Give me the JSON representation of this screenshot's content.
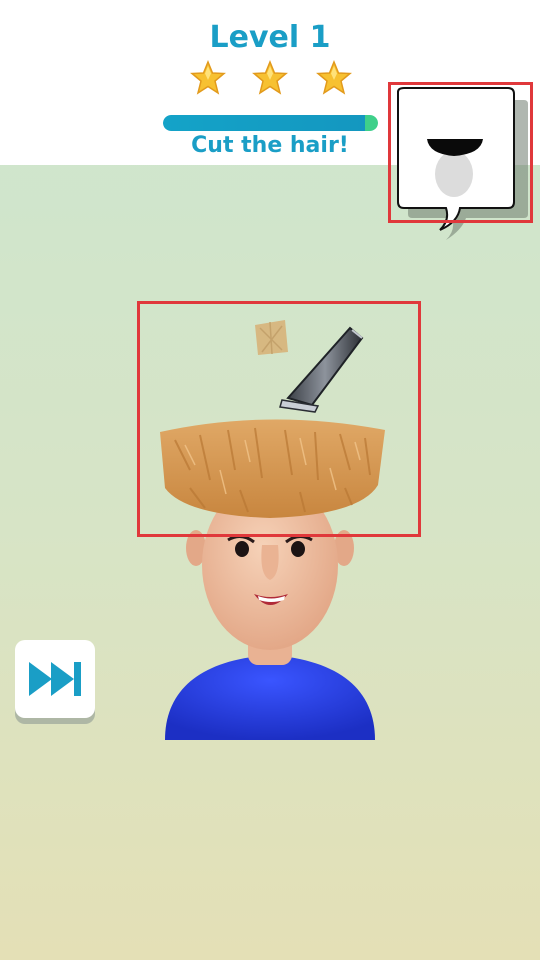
{
  "header": {
    "level_label": "Level 1",
    "stars_total": 3,
    "stars_earned": 3,
    "progress_fraction": 1.0,
    "instruction": "Cut the hair!"
  },
  "preview": {
    "icon": "target-haircut-preview-icon"
  },
  "controls": {
    "skip_icon": "fast-forward-icon"
  },
  "colors": {
    "accent": "#1a9ec6",
    "highlight": "#e0383b",
    "shirt": "#2a3fe0",
    "hair": "#d39a55",
    "skin": "#f2c6a8"
  }
}
